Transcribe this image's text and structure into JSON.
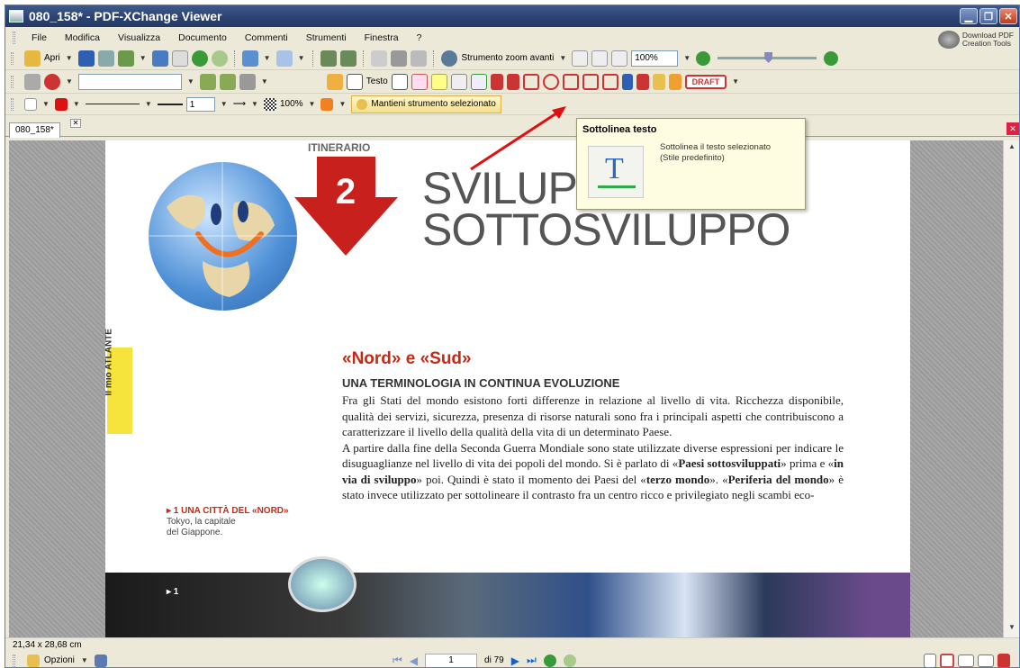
{
  "window": {
    "title": "080_158* - PDF-XChange Viewer",
    "min": "▁",
    "max": "❐",
    "close": "✕"
  },
  "menu": [
    "File",
    "Modifica",
    "Visualizza",
    "Documento",
    "Commenti",
    "Strumenti",
    "Finestra",
    "?"
  ],
  "download": {
    "line1": "Download PDF",
    "line2": "Creation Tools"
  },
  "toolbar1": {
    "open_label": "Apri",
    "zoom_tool_label": "Strumento zoom avanti",
    "zoom_value": "100%"
  },
  "toolbar2": {
    "font_field": "",
    "testo_label": "Testo",
    "draft_label": "DRAFT"
  },
  "toolbar3": {
    "line_width": "1",
    "opacity": "100%",
    "keep_tool_label": "Mantieni strumento selezionato"
  },
  "tab": {
    "name": "080_158*",
    "close": "✕"
  },
  "tooltip": {
    "title": "Sottolinea testo",
    "desc1": "Sottolinea il testo selezionato",
    "desc2": "(Stile predefinito)",
    "icon_letter": "T"
  },
  "doc": {
    "itinerario": "ITINERARIO",
    "number": "2",
    "title1": "SVILUPPO E",
    "title2": "SOTTOSVILUPPO",
    "badge": "Il mio ATLANTE",
    "heading": "«Nord» e «Sud»",
    "subheading": "UNA TERMINOLOGIA IN CONTINUA EVOLUZIONE",
    "para1": "Fra gli Stati del mondo esistono forti differenze in relazione al livello di vita. Ricchezza disponibile, qualità dei servizi, sicurezza, presenza di risorse naturali sono fra i principali aspetti che contribuiscono a caratterizzare il livello della qualità della vita di un determinato Paese.",
    "para2a": "A partire dalla fine della Seconda Guerra Mondiale sono state utilizzate diverse espressioni per indicare le disuguaglianze nel livello di vita dei popoli del mondo. Si è parlato di «",
    "para2b": "Paesi sottosviluppati",
    "para2c": "» prima e «",
    "para2d": "in via di sviluppo",
    "para2e": "» poi. Quindi è stato il momento dei Paesi del «",
    "para2f": "terzo mondo",
    "para2g": "». «",
    "para2h": "Periferia del mondo",
    "para2i": "» è stato invece utilizzato per sottolineare il contrasto fra un centro ricco e privilegiato negli scambi eco-",
    "caption_title": "▸ 1 UNA CITTÀ DEL «NORD»",
    "caption_1": "Tokyo, la capitale",
    "caption_2": "del Giappone.",
    "photo_label": "▸ 1"
  },
  "status": {
    "size": "21,34 x 28,68 cm"
  },
  "bottom": {
    "options_label": "Opzioni",
    "page": "1",
    "of": "di 79"
  }
}
